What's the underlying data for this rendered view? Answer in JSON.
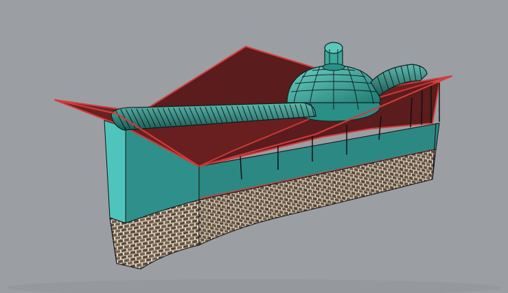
{
  "viewport": {
    "background": "#9b9ea3"
  },
  "colors": {
    "roof_fill": "#5a1c1c",
    "roof_edge": "#d43a3a",
    "wall_teal": "#2f8f8a",
    "wall_teal_light": "#4fc4bd",
    "wall_teal_dark": "#1f6e6a",
    "brick_base": "#6e5a44",
    "brick_mortar": "#e9e1d2",
    "brick_dark": "#2a2118",
    "vault_fill": "#2f7d74",
    "vault_rib": "#0d1f1d",
    "dome_fill": "#3da79c",
    "dome_rib": "#0e2321",
    "edge": "#101010"
  },
  "icons": {
    "scene": "3d-model-render"
  }
}
